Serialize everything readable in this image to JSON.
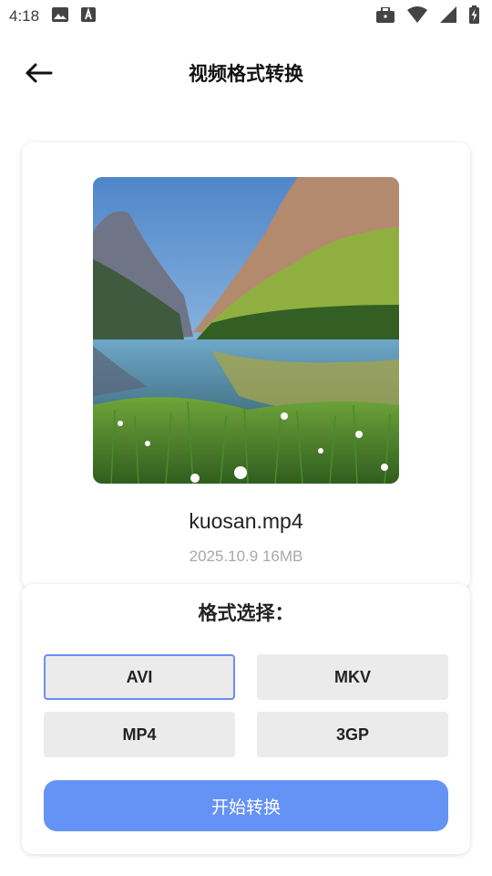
{
  "status_bar": {
    "time": "4:18",
    "left_icons": [
      "image-icon",
      "text-a-icon"
    ],
    "right_icons": [
      "briefcase-icon",
      "wifi-icon",
      "signal-icon",
      "battery-charging-icon"
    ]
  },
  "header": {
    "title": "视频格式转换",
    "back_icon": "arrow-left-icon"
  },
  "file": {
    "name": "kuosan.mp4",
    "meta": "2025.10.9 16MB",
    "thumbnail": "mountain-lake-landscape"
  },
  "format": {
    "title": "格式选择：",
    "options": [
      "AVI",
      "MKV",
      "MP4",
      "3GP"
    ],
    "selected": "AVI"
  },
  "actions": {
    "start_label": "开始转换"
  },
  "colors": {
    "accent": "#6592f5",
    "selected_border": "#6b8ef0",
    "option_bg": "#ebebeb",
    "meta_text": "#a8a8a8"
  }
}
